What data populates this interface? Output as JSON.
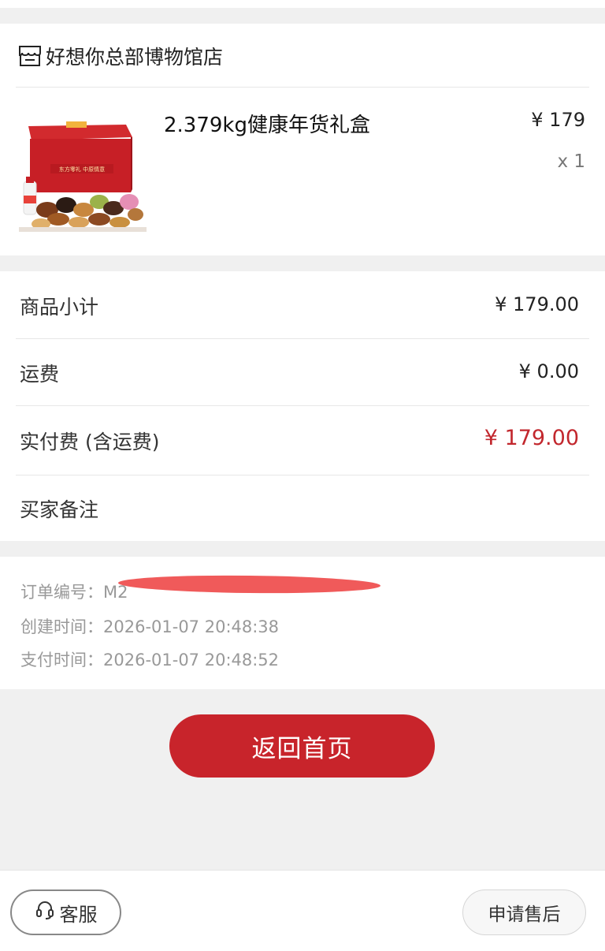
{
  "store": {
    "name": "好想你总部博物馆店",
    "icon": "store-icon"
  },
  "product": {
    "title": "2.379kg健康年货礼盒",
    "price": "¥ 179",
    "quantity": "x 1",
    "image_icon": "gift-box-image",
    "box_label": "东方零礼 中原情意"
  },
  "summary": {
    "subtotal_label": "商品小计",
    "subtotal_value": "¥ 179.00",
    "shipping_label": "运费",
    "shipping_value": "¥ 0.00",
    "paid_label": "实付费 (含运费)",
    "paid_value": "¥ 179.00",
    "note_label": "买家备注"
  },
  "order_info": {
    "order_no": "订单编号：M2",
    "created": "创建时间：2026-01-07 20:48:38",
    "paid_time": "支付时间：2026-01-07 20:48:52"
  },
  "actions": {
    "home_label": "返回首页",
    "customer_service_label": "客服",
    "customer_service_icon": "headset-icon",
    "aftersale_label": "申请售后"
  },
  "colors": {
    "accent": "#c8242b",
    "price_red": "#c2272d",
    "background": "#f0f0f0"
  }
}
